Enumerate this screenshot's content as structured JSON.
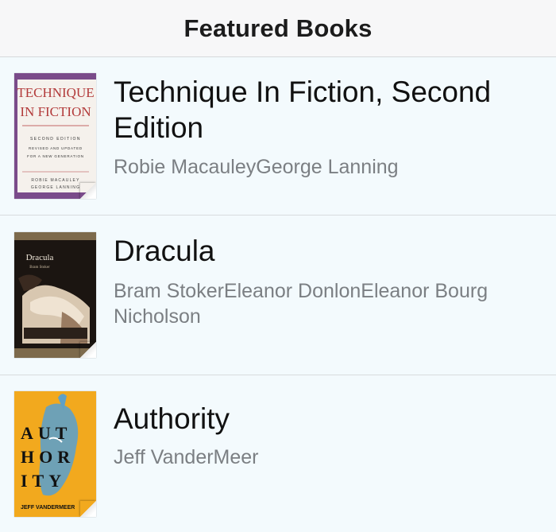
{
  "header": {
    "title": "Featured Books"
  },
  "books": [
    {
      "title": "Technique In Fiction, Second Edition",
      "authors": "Robie MacauleyGeorge Lanning",
      "cover": {
        "line1": "TECHNIQUE",
        "line2": "IN FICTION",
        "sub1": "SECOND EDITION",
        "sub2": "REVISED AND UPDATED",
        "sub3": "FOR A NEW GENERATION",
        "sub4": "ROBIE MACAULEY",
        "sub5": "GEORGE LANNING",
        "accent_color": "#7a4b8a",
        "title_color": "#b23a3a"
      }
    },
    {
      "title": "Dracula",
      "authors": "Bram StokerEleanor DonlonEleanor Bourg Nicholson",
      "cover": {
        "line1": "Dracula",
        "line2": "Bram Stoker",
        "bg_color": "#1b1511"
      }
    },
    {
      "title": "Authority",
      "authors": "Jeff VanderMeer",
      "cover": {
        "row1": "AUT",
        "row2": "HOR",
        "row3": "ITY",
        "bottom": "JEFF VANDERMEER",
        "bg_color": "#f2a91e",
        "figure_color": "#5fa0c6"
      }
    }
  ]
}
